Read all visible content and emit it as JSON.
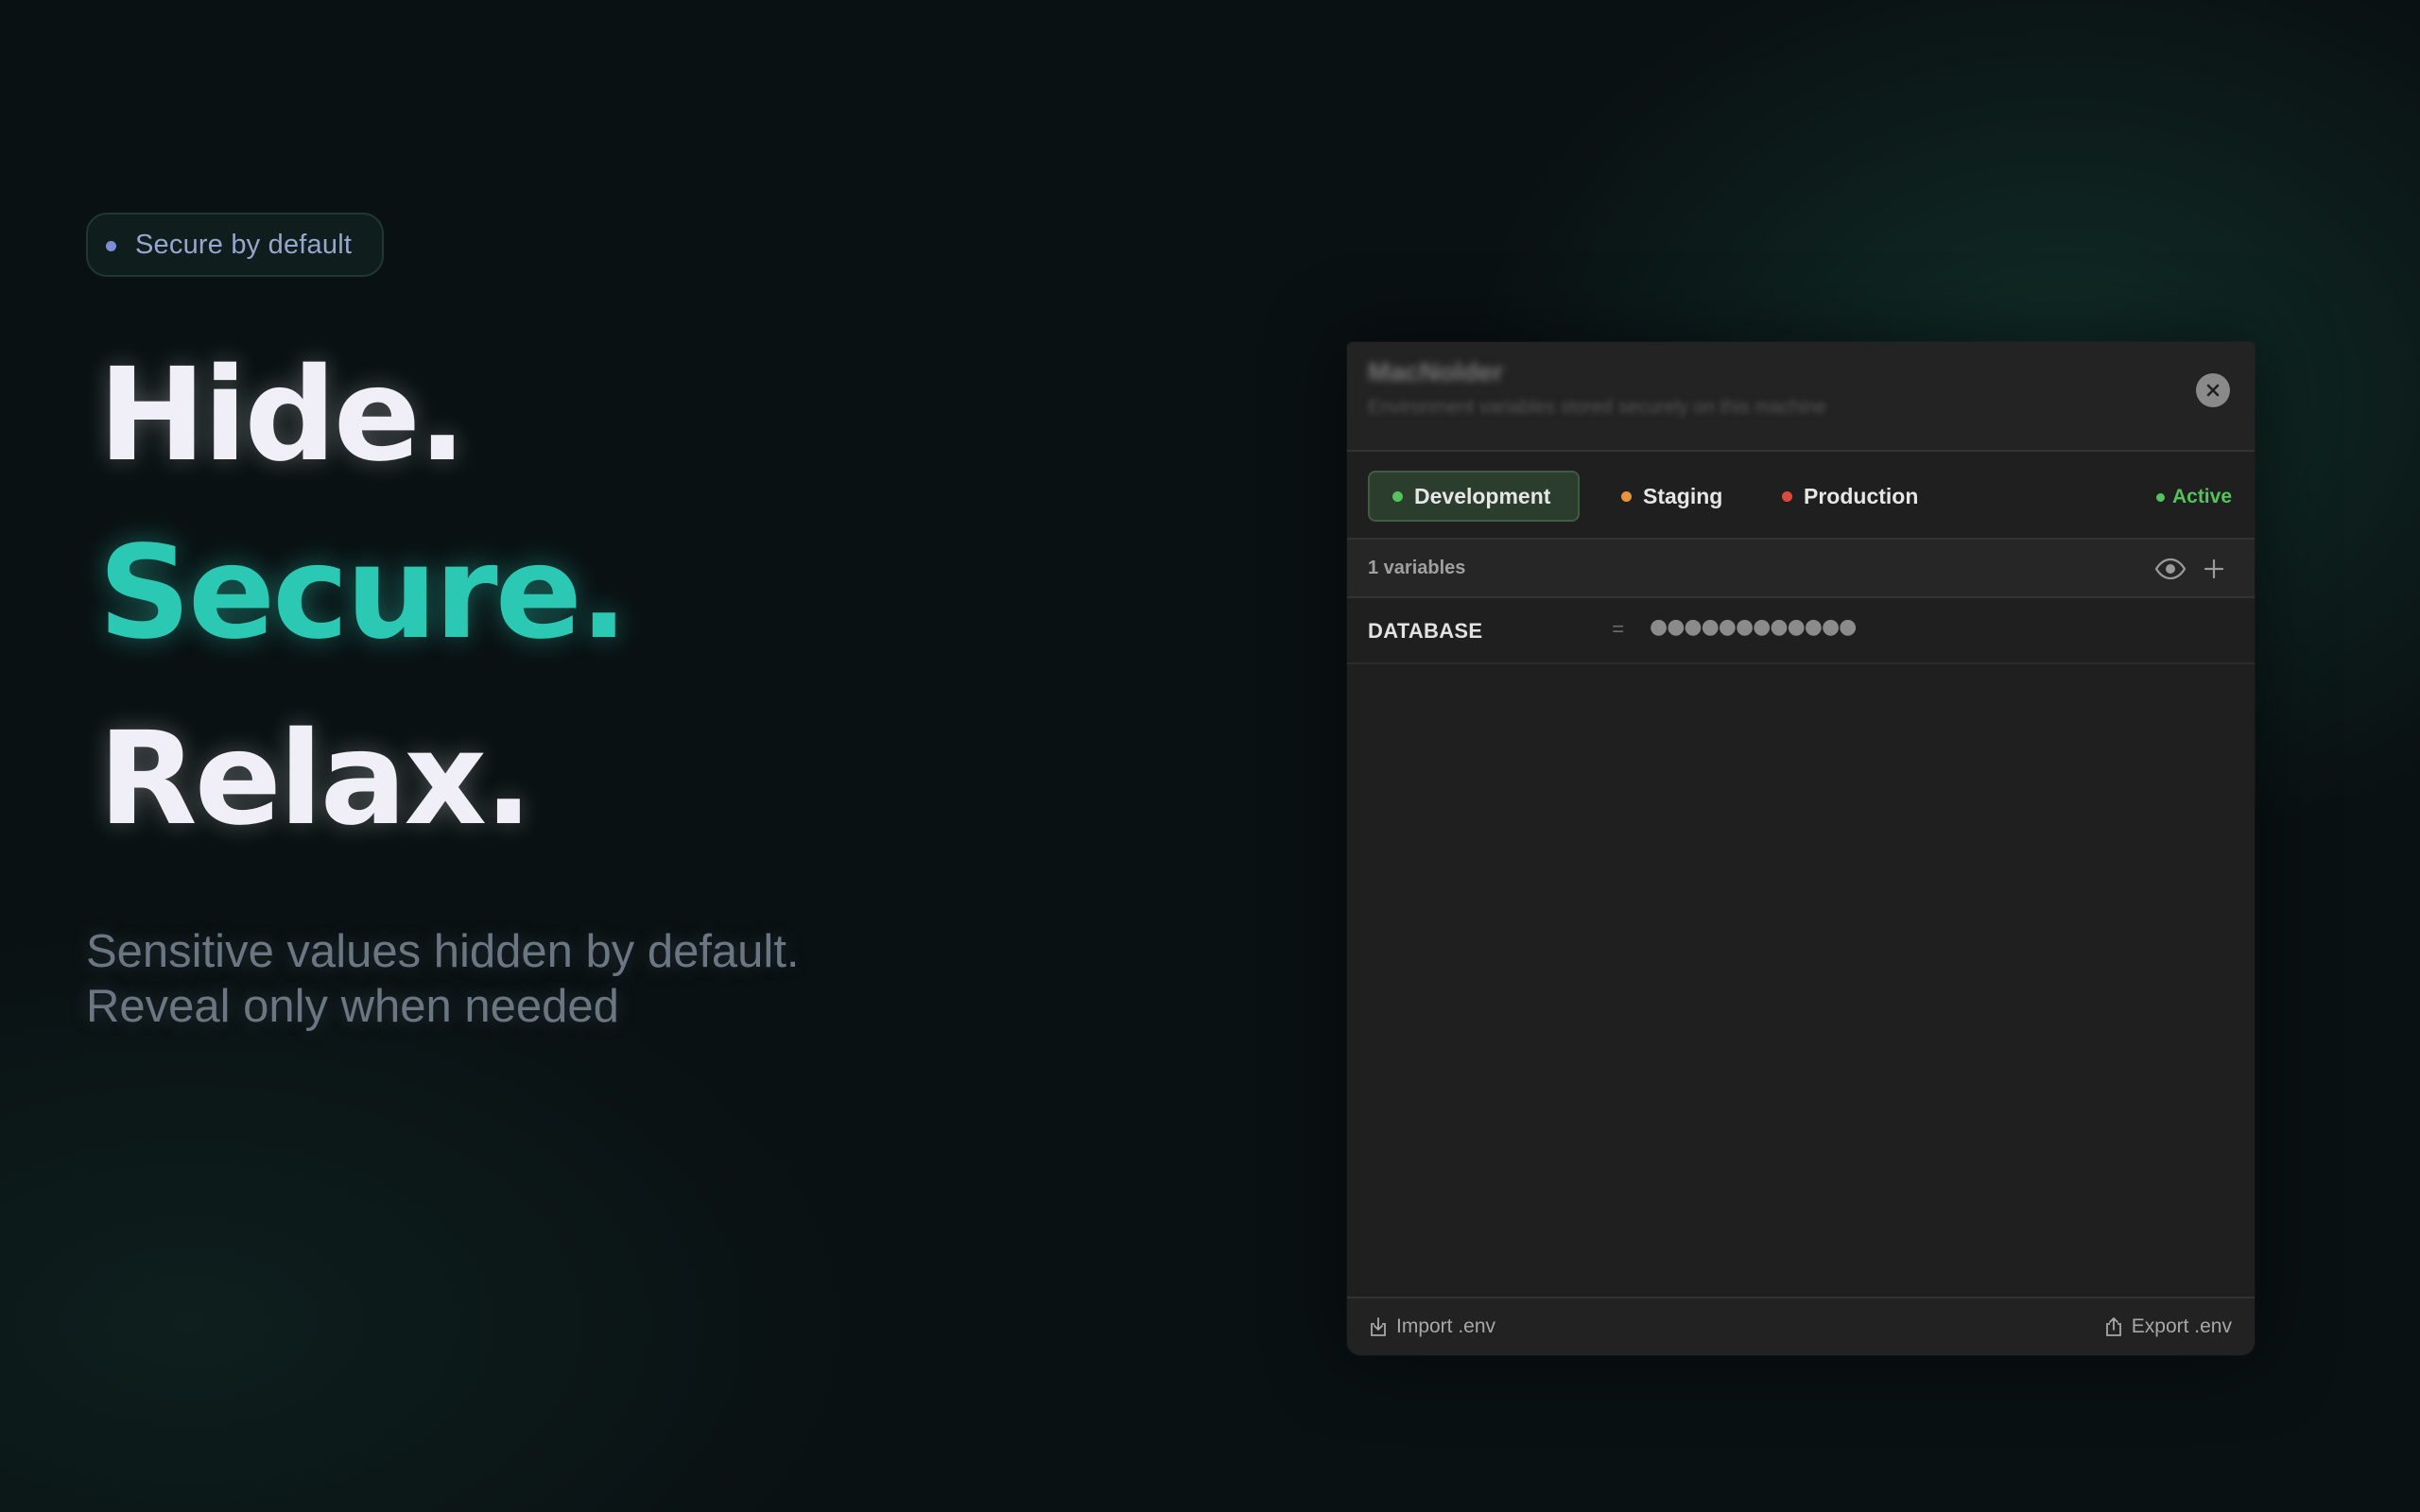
{
  "badge": {
    "label": "Secure by default"
  },
  "headline": {
    "line1": "Hide.",
    "line2": "Secure.",
    "line3": "Relax."
  },
  "subtext": {
    "line1": "Sensitive values hidden by default.",
    "line2": "Reveal only when needed"
  },
  "colors": {
    "accent": "#2bc9b4",
    "development": "#52c45a",
    "staging": "#e8943a",
    "production": "#e0483d",
    "active": "#52c45a"
  },
  "window": {
    "title": "MacNolder",
    "subtitle": "Environment variables stored securely on this machine",
    "close_icon": "close-icon",
    "environments": [
      {
        "label": "Development",
        "color": "#52c45a",
        "selected": true
      },
      {
        "label": "Staging",
        "color": "#e8943a",
        "selected": false
      },
      {
        "label": "Production",
        "color": "#e0483d",
        "selected": false
      }
    ],
    "status": "Active",
    "variables_count_label": "1 variables",
    "toolbar_icons": [
      "eye-icon",
      "plus-icon"
    ],
    "variables": [
      {
        "key": "DATABASE",
        "separator": "=",
        "masked_value": "●●●●●●●●●●●●"
      }
    ],
    "footer": {
      "import_label": "Import .env",
      "export_label": "Export .env"
    }
  }
}
